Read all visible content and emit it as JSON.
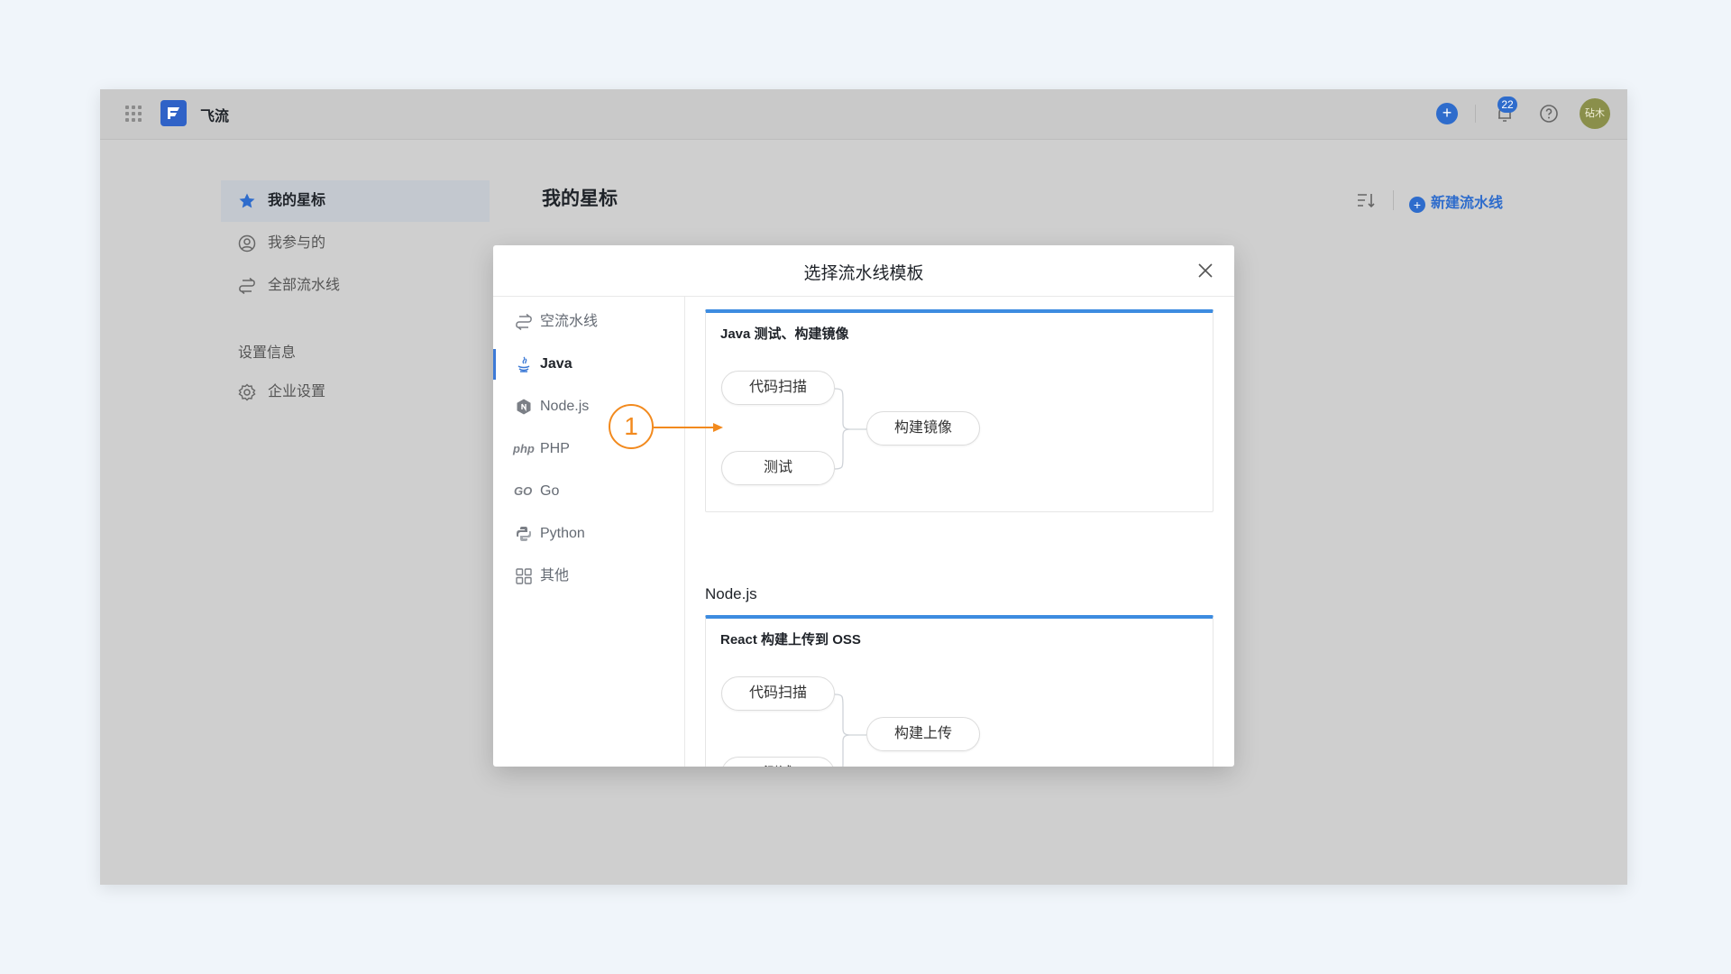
{
  "app": {
    "name": "飞流",
    "notification_count": "22",
    "avatar_text": "砧木",
    "accent_color": "#2e6ccc"
  },
  "sidebar": {
    "items": [
      {
        "label": "我的星标",
        "icon": "star-icon",
        "active": true
      },
      {
        "label": "我参与的",
        "icon": "user-icon",
        "active": false
      },
      {
        "label": "全部流水线",
        "icon": "pipeline-icon",
        "active": false
      }
    ],
    "section_label": "设置信息",
    "settings_item": {
      "label": "企业设置",
      "icon": "gear-icon"
    }
  },
  "main": {
    "title": "我的星标",
    "new_pipeline_label": "新建流水线"
  },
  "modal": {
    "title": "选择流水线模板",
    "categories": [
      {
        "label": "空流水线",
        "icon": "pipeline-icon"
      },
      {
        "label": "Java",
        "icon": "java-icon",
        "active": true
      },
      {
        "label": "Node.js",
        "icon": "nodejs-icon"
      },
      {
        "label": "PHP",
        "icon": "php-icon"
      },
      {
        "label": "Go",
        "icon": "go-icon"
      },
      {
        "label": "Python",
        "icon": "python-icon"
      },
      {
        "label": "其他",
        "icon": "apps-icon"
      }
    ],
    "templates": [
      {
        "title": "Java 测试、构建镜像",
        "stages": {
          "left_top": "代码扫描",
          "left_bottom": "测试",
          "right": "构建镜像"
        }
      }
    ],
    "group_title": "Node.js",
    "node_templates": [
      {
        "title": "React 构建上传到 OSS",
        "stages": {
          "left_top": "代码扫描",
          "left_bottom": "测试",
          "right": "构建上传"
        }
      }
    ]
  },
  "callout": {
    "number": "1",
    "color": "#f28a1e"
  }
}
